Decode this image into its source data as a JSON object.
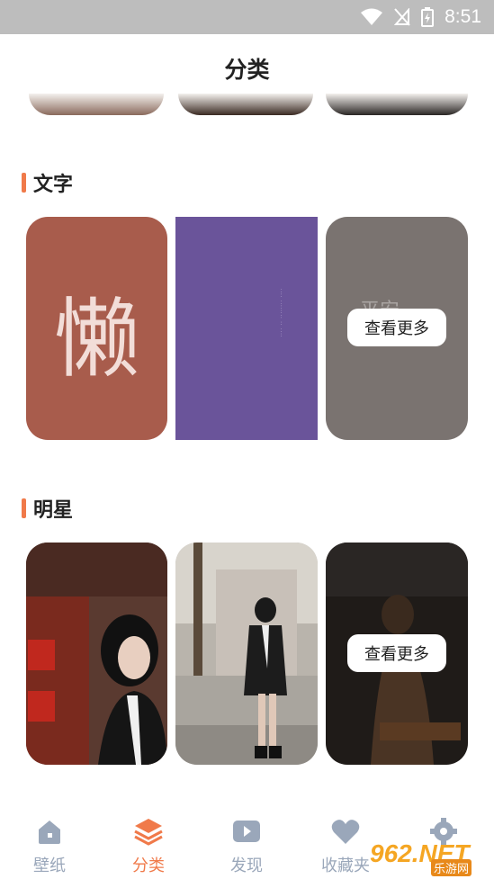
{
  "status_bar": {
    "time": "8:51"
  },
  "header": {
    "title": "分类"
  },
  "sections": [
    {
      "title": "文字",
      "more_label": "查看更多",
      "card_texts": [
        "懒",
        "平安"
      ]
    },
    {
      "title": "明星",
      "more_label": "查看更多"
    }
  ],
  "tabs": [
    {
      "label": "壁纸",
      "icon": "home-icon"
    },
    {
      "label": "分类",
      "icon": "layers-icon",
      "active": true
    },
    {
      "label": "发现",
      "icon": "video-icon"
    },
    {
      "label": "收藏夹",
      "icon": "heart-icon"
    },
    {
      "label": "",
      "icon": "gear-icon"
    }
  ],
  "watermark": {
    "brand": "962.NET",
    "sub": "乐游网"
  },
  "colors": {
    "accent": "#f07a4a",
    "tab_inactive": "#9aa7ba",
    "card_red": "#a85c4c",
    "card_purple": "#6a549a",
    "card_gray": "#7a7370"
  }
}
